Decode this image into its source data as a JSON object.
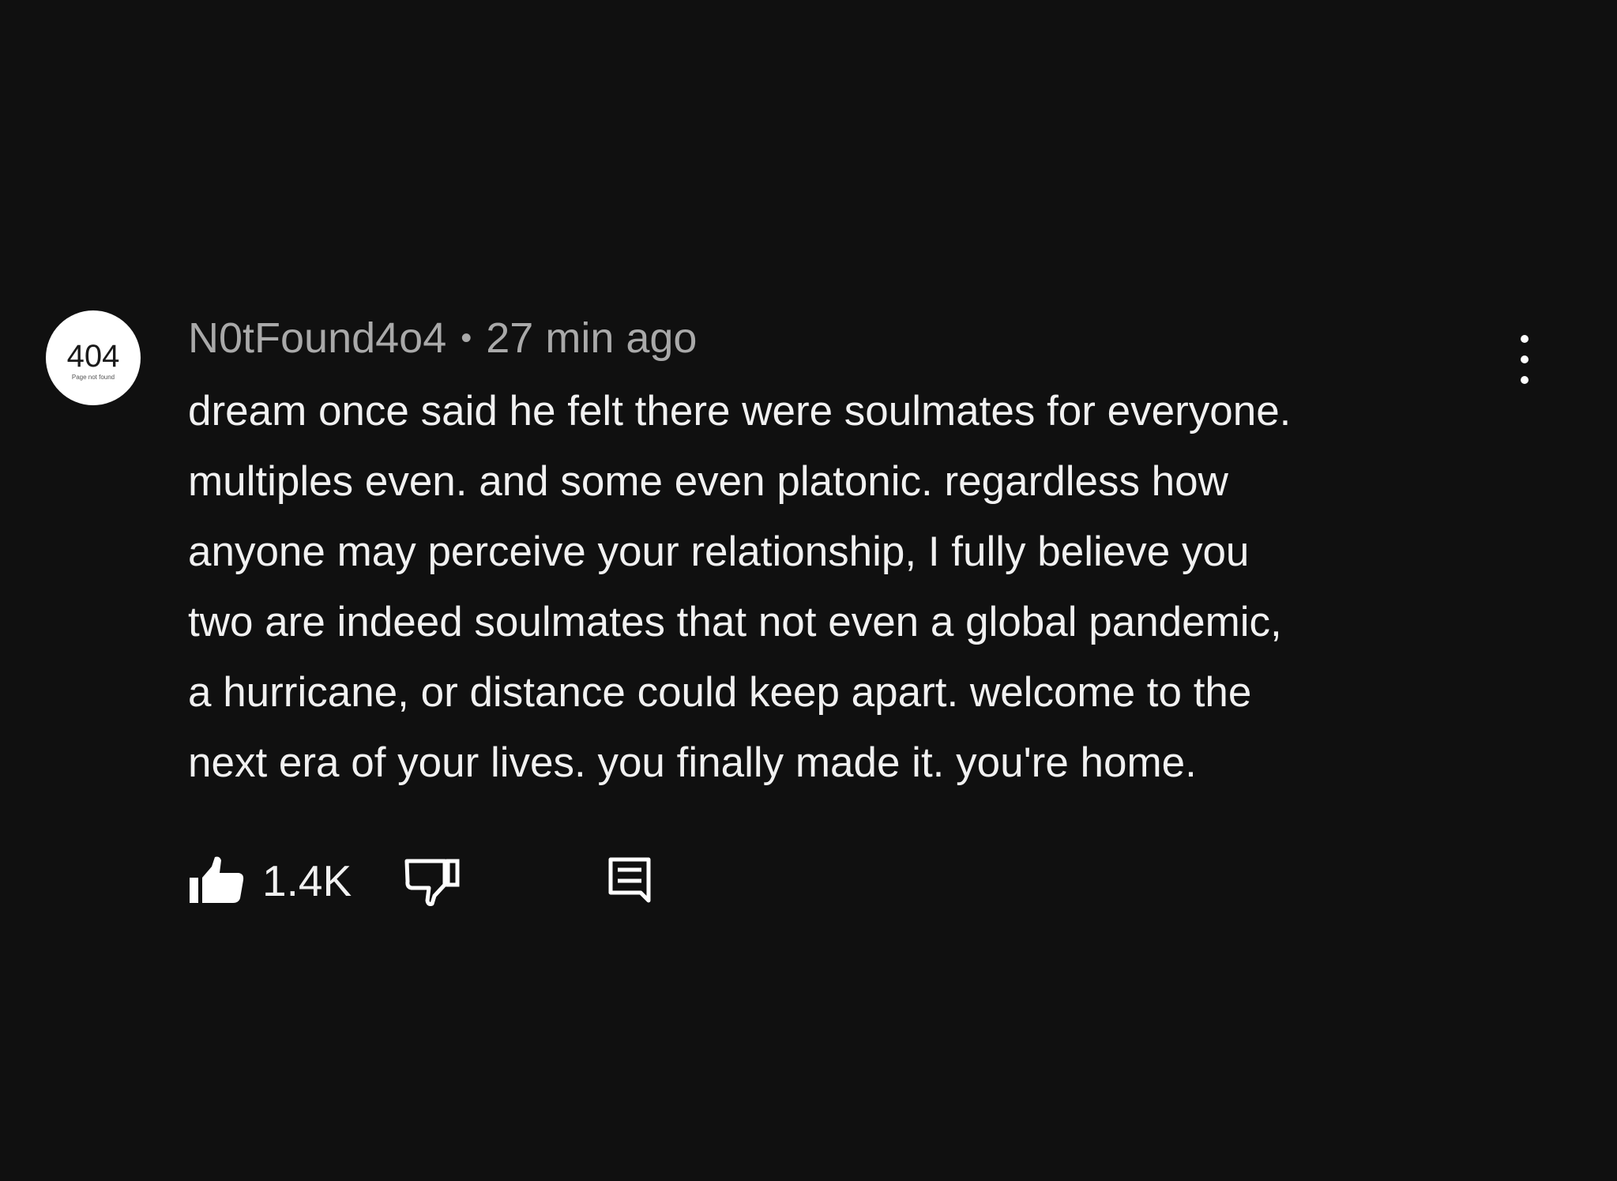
{
  "comment": {
    "avatar": {
      "code": "404",
      "subtitle": "Page not found"
    },
    "author": "N0tFound4o4",
    "separator": "•",
    "timestamp": "27 min ago",
    "lines": [
      "dream once said he felt there were soulmates for everyone.",
      "multiples even. and some even platonic. regardless how",
      "anyone may perceive your relationship, I fully believe you",
      "two are indeed soulmates that not even a global pandemic,",
      "a hurricane, or distance could keep apart. welcome to the",
      "next era of your lives. you finally made it. you're home."
    ],
    "likes": "1.4K",
    "icons": {
      "like": "thumbs-up-icon",
      "dislike": "thumbs-down-icon",
      "reply": "comment-reply-icon",
      "more": "more-vertical-icon"
    }
  },
  "colors": {
    "background": "#101010",
    "text": "#f1f1f1",
    "muted": "#a9a9a9"
  }
}
